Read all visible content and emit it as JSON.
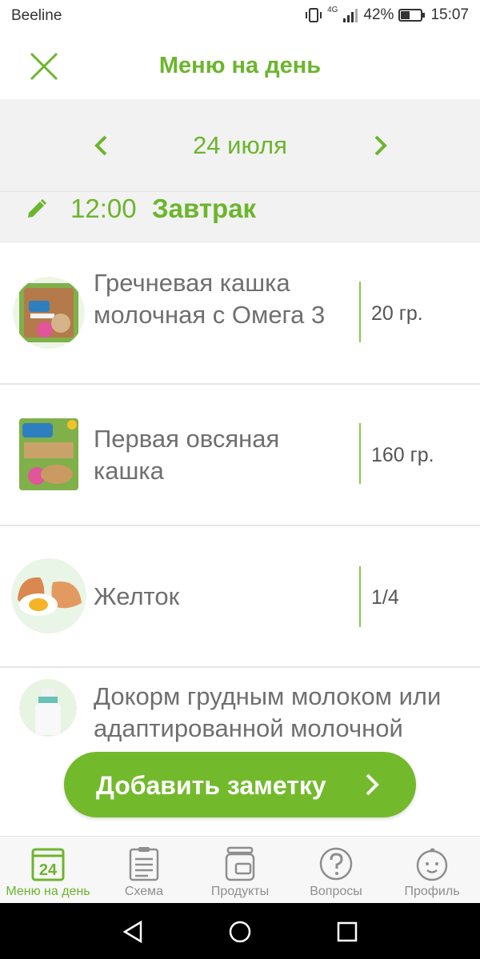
{
  "status_bar": {
    "carrier": "Beeline",
    "network": "4G",
    "battery": "42%",
    "time": "15:07"
  },
  "header": {
    "title": "Меню на день",
    "close_icon": "close-icon"
  },
  "date_nav": {
    "date": "24 июля"
  },
  "meal": {
    "time": "12:00",
    "name": "Завтрак"
  },
  "items": [
    {
      "name": "Гречневая кашка молочная с Омега 3",
      "amount": "20 гр."
    },
    {
      "name": "Первая овсяная кашка",
      "amount": "160 гр."
    },
    {
      "name": "Желток",
      "amount": "1/4"
    },
    {
      "name": "Докорм грудным молоком или адаптированной молочной"
    }
  ],
  "add_note_button": {
    "label": "Добавить заметку"
  },
  "bottom_nav": {
    "tabs": [
      {
        "label": "Меню на день",
        "icon": "calendar-icon",
        "badge": "24"
      },
      {
        "label": "Схема",
        "icon": "clipboard-icon"
      },
      {
        "label": "Продукты",
        "icon": "jar-icon"
      },
      {
        "label": "Вопросы",
        "icon": "question-icon"
      },
      {
        "label": "Профиль",
        "icon": "baby-face-icon"
      }
    ]
  },
  "colors": {
    "accent": "#6cb52d",
    "button": "#72ba2b",
    "divider": "#8cc653"
  }
}
